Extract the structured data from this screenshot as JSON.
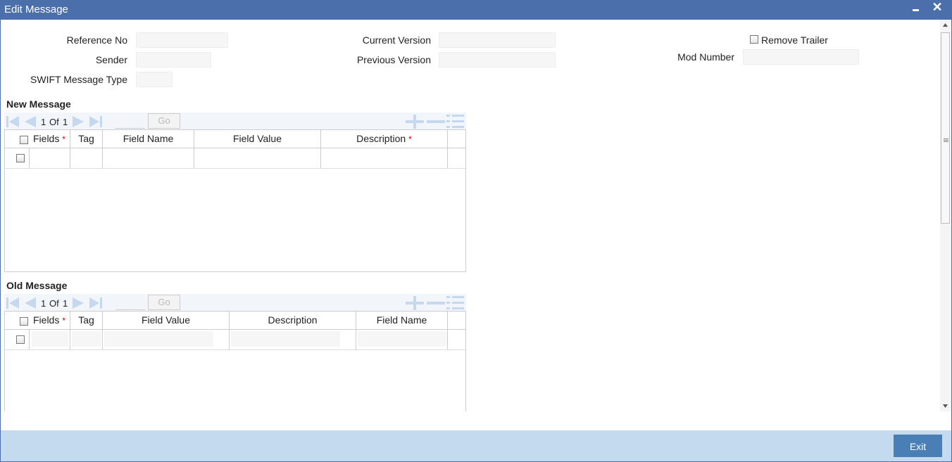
{
  "window": {
    "title": "Edit Message"
  },
  "form": {
    "reference_no": {
      "label": "Reference No",
      "value": ""
    },
    "sender": {
      "label": "Sender",
      "value": ""
    },
    "swift_message_type": {
      "label": "SWIFT Message Type",
      "value": ""
    },
    "current_version": {
      "label": "Current Version",
      "value": ""
    },
    "previous_version": {
      "label": "Previous Version",
      "value": ""
    },
    "remove_trailer": {
      "label": "Remove Trailer",
      "checked": false
    },
    "mod_number": {
      "label": "Mod Number",
      "value": ""
    }
  },
  "new_message": {
    "title": "New Message",
    "pager": {
      "current": "1",
      "of_label": "Of",
      "total": "1",
      "go_label": "Go"
    },
    "columns": [
      "Fields",
      "Tag",
      "Field Name",
      "Field Value",
      "Description"
    ],
    "required_marker": "*"
  },
  "old_message": {
    "title": "Old Message",
    "pager": {
      "current": "1",
      "of_label": "Of",
      "total": "1",
      "go_label": "Go"
    },
    "columns": [
      "Fields",
      "Tag",
      "Field Value",
      "Description",
      "Field Name"
    ],
    "required_marker": "*"
  },
  "footer": {
    "exit_label": "Exit"
  },
  "colors": {
    "titlebar": "#4a6fab",
    "footer": "#c4daee",
    "button": "#4a7fb5",
    "required": "#cc0000",
    "icons_disabled": "#c5d8ee"
  }
}
